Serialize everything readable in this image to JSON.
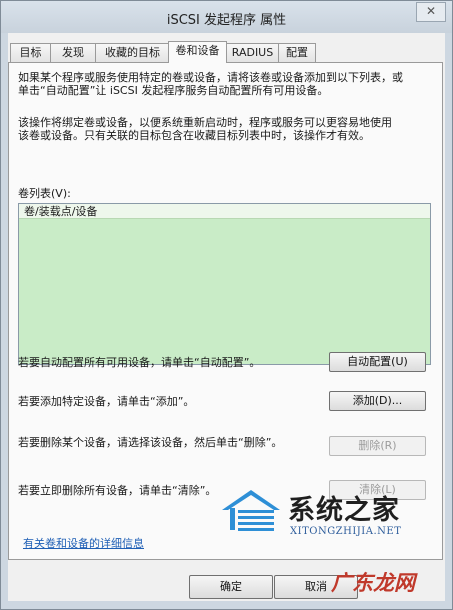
{
  "window": {
    "title": "iSCSI 发起程序 属性",
    "close_glyph": "✕"
  },
  "tabs": [
    {
      "label": "目标"
    },
    {
      "label": "发现"
    },
    {
      "label": "收藏的目标"
    },
    {
      "label": "卷和设备"
    },
    {
      "label": "RADIUS"
    },
    {
      "label": "配置"
    }
  ],
  "active_tab": "卷和设备",
  "panel": {
    "intro1_line1": "如果某个程序或服务使用特定的卷或设备，请将该卷或设备添加到以下列表，或",
    "intro1_line2": "单击“自动配置”让 iSCSI 发起程序服务自动配置所有可用设备。",
    "intro2_line1": "该操作将绑定卷或设备，以便系统重新启动时，程序或服务可以更容易地使用",
    "intro2_line2": "该卷或设备。只有关联的目标包含在收藏目标列表中时，该操作才有效。",
    "list_label": "卷列表(V):",
    "list_column": "卷/装载点/设备",
    "list_rows": [],
    "autoconfig_text": "若要自动配置所有可用设备，请单击“自动配置”。",
    "autoconfig_button": "自动配置(U)",
    "add_text": "若要添加特定设备，请单击“添加”。",
    "add_button": "添加(D)...",
    "remove_text": "若要删除某个设备，请选择该设备，然后单击“删除”。",
    "remove_button": "删除(R)",
    "clear_text": "若要立即删除所有设备，请单击“清除”。",
    "clear_button": "清除(L)",
    "details_link": "有关卷和设备的详细信息"
  },
  "footer": {
    "ok_button": "确定",
    "cancel_button": "取消"
  },
  "watermarks": {
    "site_cn": "系统之家",
    "site_url": "XITONGZHIJIA.NET",
    "site2": "广东龙网"
  },
  "colors": {
    "list_background": "#c9ecc7",
    "link": "#1f5fb5"
  }
}
